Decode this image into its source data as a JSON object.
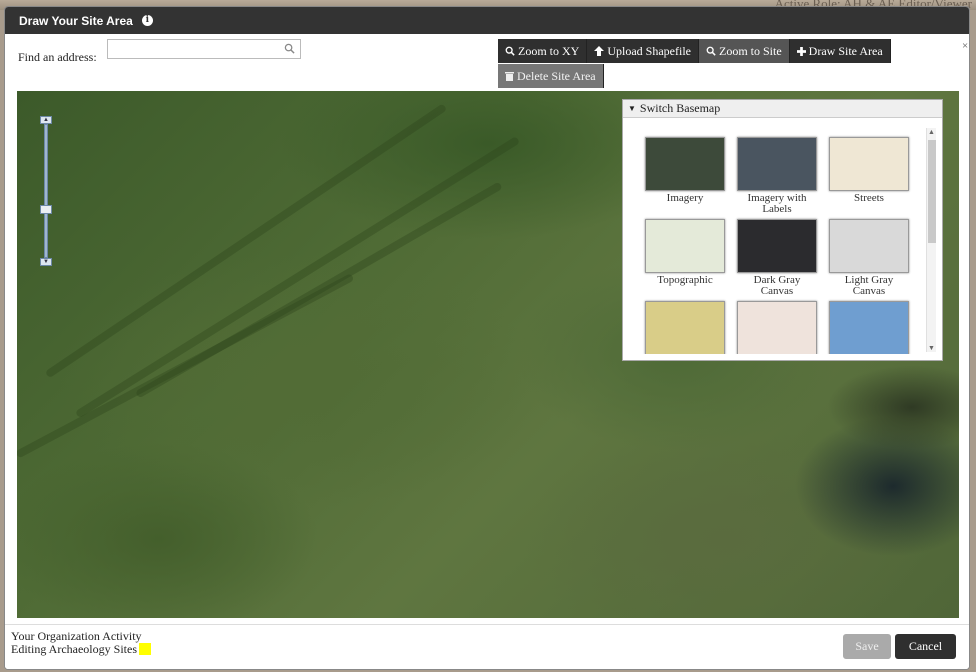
{
  "background": {
    "role_text": "Active Role: AH & AE Editor/Viewer"
  },
  "dialog": {
    "title": "Draw Your Site Area",
    "info_icon": "info-icon"
  },
  "search": {
    "label": "Find an address:",
    "value": "",
    "placeholder": ""
  },
  "toolbar": {
    "zoom_xy": "Zoom to XY",
    "upload": "Upload Shapefile",
    "zoom_site": "Zoom to Site",
    "draw": "Draw Site Area",
    "delete": "Delete Site Area"
  },
  "basemap": {
    "header": "Switch Basemap",
    "items": [
      {
        "label": "Imagery",
        "color": "#3d4a3a"
      },
      {
        "label": "Imagery with Labels",
        "color": "#4a5560"
      },
      {
        "label": "Streets",
        "color": "#efe7d4"
      },
      {
        "label": "Topographic",
        "color": "#e4ead9"
      },
      {
        "label": "Dark Gray Canvas",
        "color": "#2b2b2e"
      },
      {
        "label": "Light Gray Canvas",
        "color": "#d9d9d9"
      },
      {
        "label": "",
        "color": "#d9cd88"
      },
      {
        "label": "",
        "color": "#efe3dc"
      },
      {
        "label": "",
        "color": "#6f9ed0"
      }
    ]
  },
  "footer": {
    "org_title": "Your Organization Activity",
    "org_sub": "Editing Archaeology Sites",
    "highlight_color": "#ffff00",
    "save": "Save",
    "cancel": "Cancel"
  }
}
